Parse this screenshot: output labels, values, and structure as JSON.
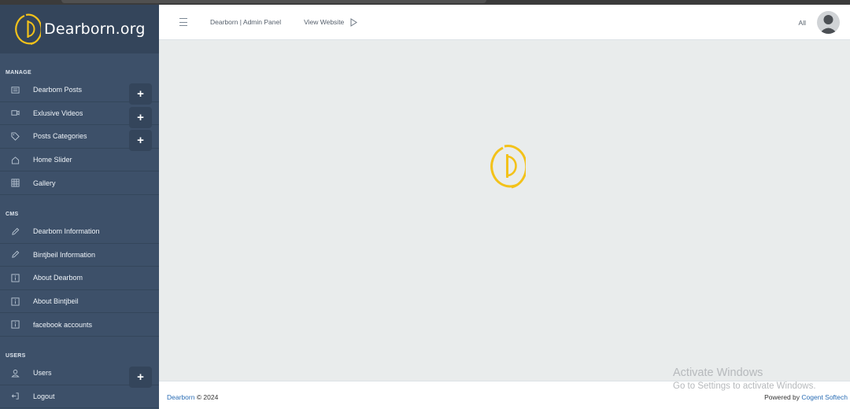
{
  "brand": {
    "name": "Dearborn.org",
    "accent": "#f3c21a"
  },
  "sidebar": {
    "sections": [
      {
        "label": "MANAGE",
        "items": [
          {
            "label": "Dearbom Posts",
            "icon": "news-icon"
          },
          {
            "label": "Exlusive Videos",
            "icon": "video-icon"
          },
          {
            "label": "Posts Categories",
            "icon": "tag-icon"
          },
          {
            "label": "Home Slider",
            "icon": "home-icon"
          },
          {
            "label": "Gallery",
            "icon": "grid-icon"
          }
        ]
      },
      {
        "label": "CMS",
        "items": [
          {
            "label": "Dearbom Information",
            "icon": "pencil-icon"
          },
          {
            "label": "Bintjbeil Information",
            "icon": "pencil-icon"
          },
          {
            "label": "About Dearbom",
            "icon": "info-icon"
          },
          {
            "label": "About Bintjbeil",
            "icon": "info-icon"
          },
          {
            "label": "facebook accounts",
            "icon": "info-icon"
          }
        ]
      },
      {
        "label": "USERS",
        "items": [
          {
            "label": "Users",
            "icon": "user-icon"
          },
          {
            "label": "Logout",
            "icon": "logout-icon"
          }
        ]
      }
    ],
    "plus_label": "+"
  },
  "topbar": {
    "breadcrumb": "Dearborn | Admin Panel",
    "view_website": "View Website",
    "language": "All"
  },
  "footer": {
    "site_link": "Dearborn",
    "copyright": "© 2024",
    "powered_by": "Powered by",
    "company": "Cogent Softech"
  },
  "watermark": {
    "title": "Activate Windows",
    "subtitle": "Go to Settings to activate Windows."
  },
  "colors": {
    "sidebar_bg": "#3d5069",
    "brand_bg": "#34455b",
    "main_bg": "#e9ecec",
    "link": "#2a6db5"
  }
}
